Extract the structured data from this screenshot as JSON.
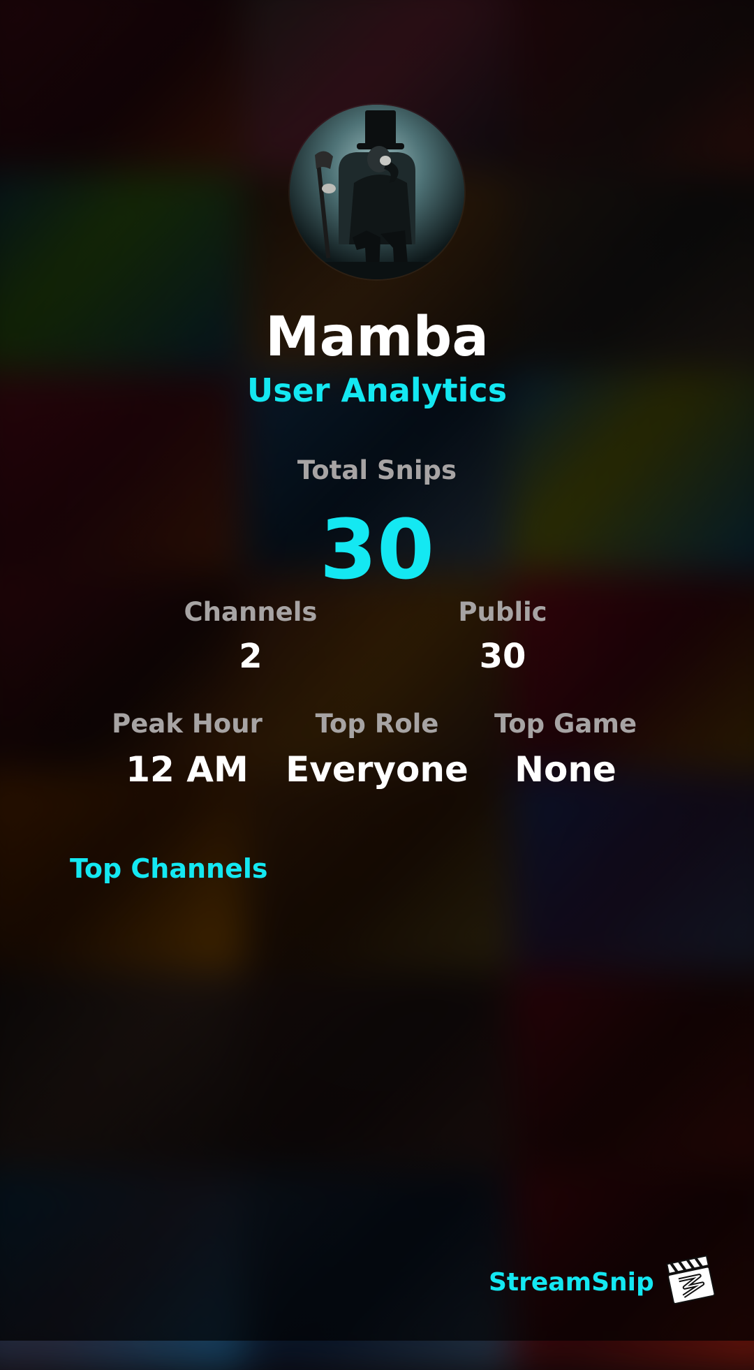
{
  "profile": {
    "username": "Mamba",
    "subtitle": "User Analytics",
    "avatar_icon": "avatar-image"
  },
  "stats": {
    "total_snips_label": "Total Snips",
    "total_snips_value": "30",
    "channels_label": "Channels",
    "channels_value": "2",
    "public_label": "Public",
    "public_value": "30",
    "peak_hour_label": "Peak Hour",
    "peak_hour_value": "12 AM",
    "top_role_label": "Top Role",
    "top_role_value": "Everyone",
    "top_game_label": "Top Game",
    "top_game_value": "None"
  },
  "sections": {
    "top_channels_title": "Top Channels"
  },
  "branding": {
    "name": "StreamSnip",
    "logo_icon": "clapperboard-logo-icon"
  },
  "colors": {
    "accent": "#14e8f2",
    "label": "#a7a4a4",
    "text": "#ffffff",
    "background": "#0b0708"
  }
}
